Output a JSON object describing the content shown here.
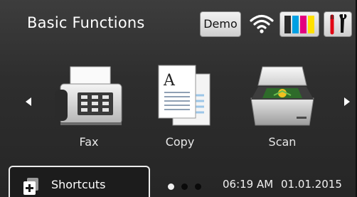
{
  "header": {
    "title": "Basic Functions",
    "demo_label": "Demo",
    "ink_colors": [
      "#2a2a2a",
      "#00a0e3",
      "#e4007f",
      "#ffe000"
    ]
  },
  "icons": {
    "wifi": "wifi-icon",
    "ink": "ink-cartridges-icon",
    "tools": "tools-icon",
    "left": "chevron-left-icon",
    "right": "chevron-right-icon",
    "shortcuts": "shortcuts-icon"
  },
  "functions": [
    {
      "label": "Fax",
      "icon": "fax-machine-icon"
    },
    {
      "label": "Copy",
      "icon": "copy-documents-icon"
    },
    {
      "label": "Scan",
      "icon": "scanner-icon"
    }
  ],
  "footer": {
    "shortcuts_label": "Shortcuts",
    "page_indicator": {
      "pages": 3,
      "current": 1
    },
    "time": "06:19 AM",
    "date": "01.01.2015"
  }
}
